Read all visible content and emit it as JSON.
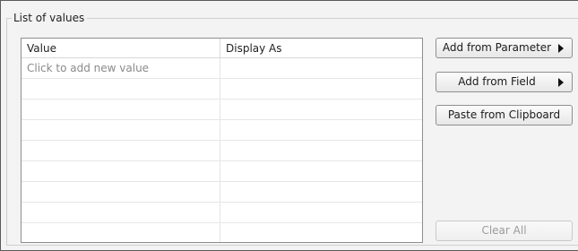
{
  "group": {
    "title": "List of values"
  },
  "grid": {
    "columns": [
      "Value",
      "Display As"
    ],
    "rows": [
      [
        "Click to add new value",
        ""
      ],
      [
        "",
        ""
      ],
      [
        "",
        ""
      ],
      [
        "",
        ""
      ],
      [
        "",
        ""
      ],
      [
        "",
        ""
      ],
      [
        "",
        ""
      ],
      [
        "",
        ""
      ],
      [
        "",
        ""
      ]
    ]
  },
  "buttons": {
    "add_from_parameter": "Add from Parameter",
    "add_from_field": "Add from Field",
    "paste_from_clipboard": "Paste from Clipboard",
    "clear_all": "Clear All",
    "clear_all_enabled": false
  }
}
